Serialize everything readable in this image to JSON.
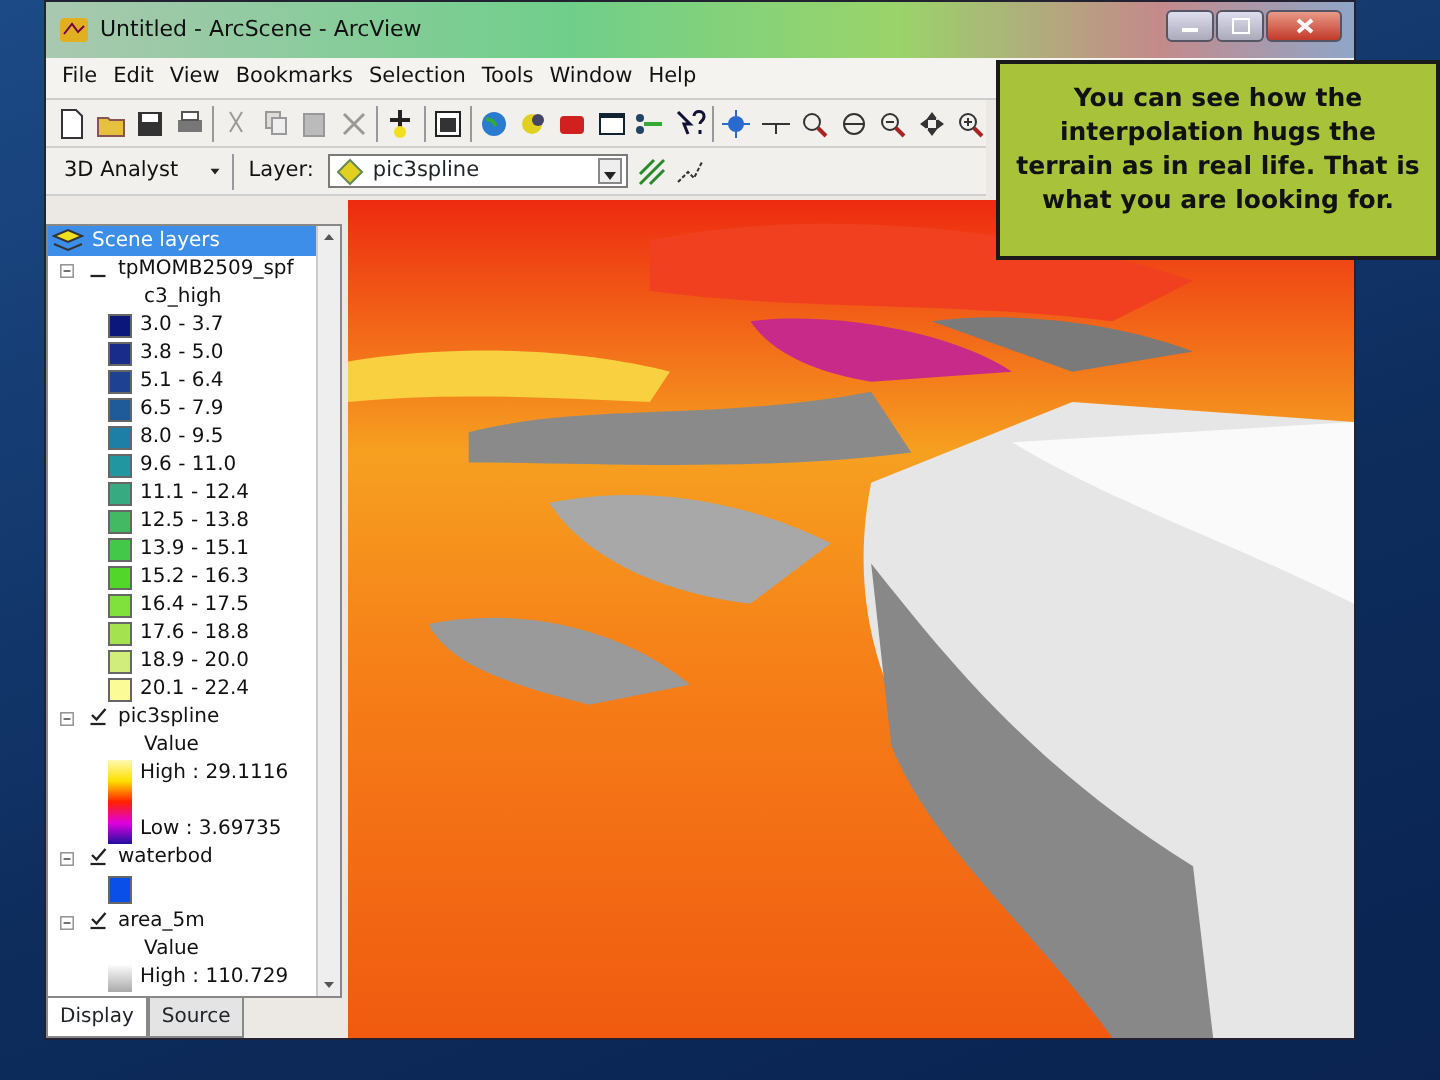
{
  "window": {
    "title": "Untitled - ArcScene - ArcView"
  },
  "menu": [
    "File",
    "Edit",
    "View",
    "Bookmarks",
    "Selection",
    "Tools",
    "Window",
    "Help"
  ],
  "analyst_toolbar": {
    "menu": "3D Analyst",
    "layer_label": "Layer:",
    "layer_value": "pic3spline"
  },
  "toc": {
    "title": "Scene layers",
    "layers": [
      {
        "name": "tpMOMB2509_spf",
        "checked": false,
        "kind": "classes",
        "field": "c3_high",
        "classes": [
          {
            "label": "3.0 - 3.7",
            "color": "#0c177a"
          },
          {
            "label": "3.8 - 5.0",
            "color": "#1a2c8a"
          },
          {
            "label": "5.1 - 6.4",
            "color": "#1e4290"
          },
          {
            "label": "6.5 - 7.9",
            "color": "#1f5b98"
          },
          {
            "label": "8.0 - 9.5",
            "color": "#1f7ea6"
          },
          {
            "label": "9.6 - 11.0",
            "color": "#22969e"
          },
          {
            "label": "11.1 - 12.4",
            "color": "#38aa82"
          },
          {
            "label": "12.5 - 13.8",
            "color": "#43b964"
          },
          {
            "label": "13.9 - 15.1",
            "color": "#44c84a"
          },
          {
            "label": "15.2 - 16.3",
            "color": "#52d62a"
          },
          {
            "label": "16.4 - 17.5",
            "color": "#80e03c"
          },
          {
            "label": "17.6 - 18.8",
            "color": "#a4e250"
          },
          {
            "label": "18.9 - 20.0",
            "color": "#d2ee7a"
          },
          {
            "label": "20.1 - 22.4",
            "color": "#fbfb98"
          }
        ]
      },
      {
        "name": "pic3spline",
        "checked": true,
        "kind": "heatramp",
        "field": "Value",
        "high": "High : 29.1116",
        "low": "Low : 3.69735"
      },
      {
        "name": "waterbod",
        "checked": true,
        "kind": "single",
        "color": "#0a50e6"
      },
      {
        "name": "area_5m",
        "checked": true,
        "kind": "greyramp",
        "field": "Value",
        "high": "High : 110.729"
      }
    ]
  },
  "tabs": [
    {
      "label": "Display",
      "selected": true
    },
    {
      "label": "Source",
      "selected": false
    }
  ],
  "callout": {
    "text": "You can see how the interpolation hugs the terrain as in real life.  That is what you are looking for."
  }
}
